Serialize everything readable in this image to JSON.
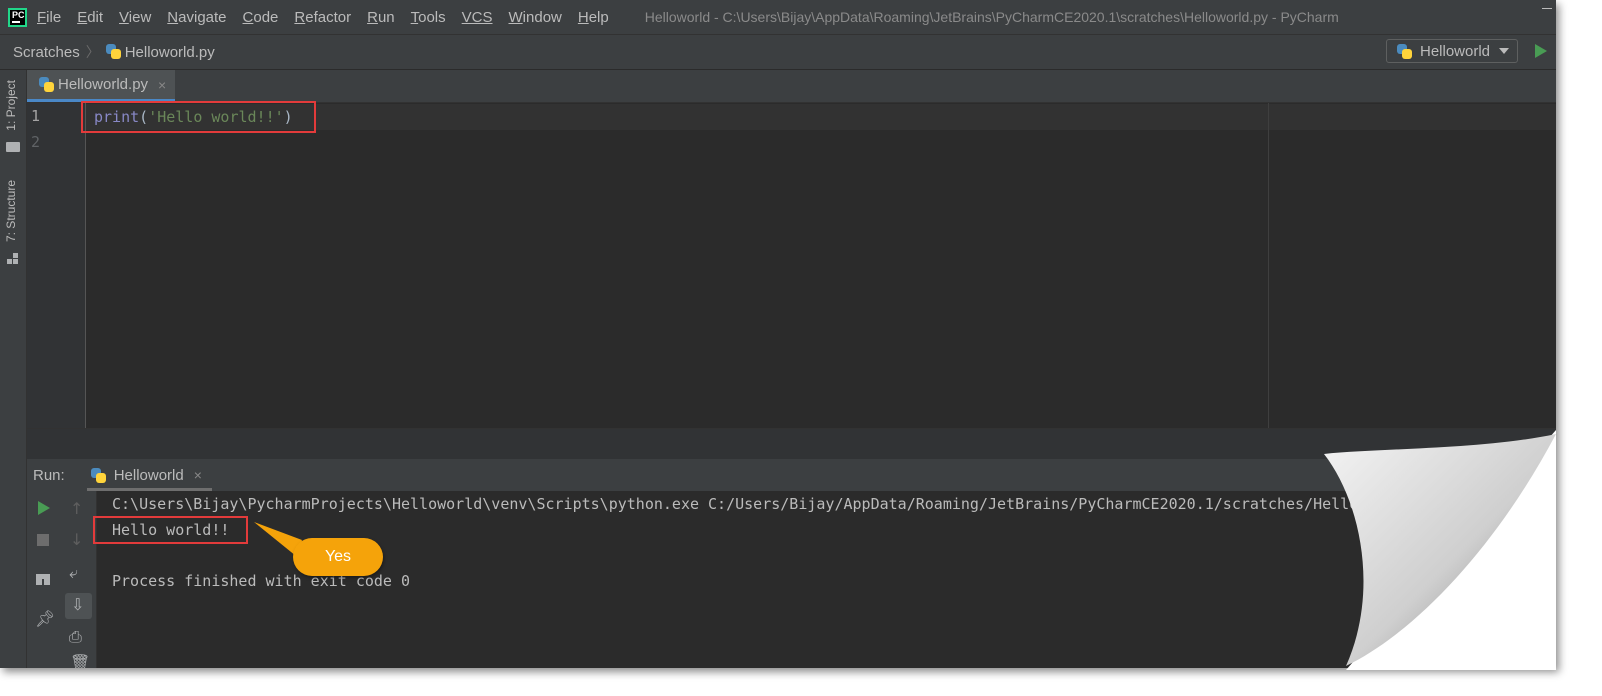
{
  "menubar": {
    "items": [
      {
        "u": "F",
        "rest": "ile"
      },
      {
        "u": "E",
        "rest": "dit"
      },
      {
        "u": "V",
        "rest": "iew"
      },
      {
        "u": "N",
        "rest": "avigate"
      },
      {
        "u": "C",
        "rest": "ode"
      },
      {
        "u": "R",
        "rest": "efactor"
      },
      {
        "u": "R",
        "rest": "un"
      },
      {
        "u": "T",
        "rest": "ools"
      },
      {
        "u": "VCS",
        "rest": ""
      },
      {
        "u": "W",
        "rest": "indow"
      },
      {
        "u": "H",
        "rest": "elp"
      }
    ],
    "window_title": "Helloworld - C:\\Users\\Bijay\\AppData\\Roaming\\JetBrains\\PyCharmCE2020.1\\scratches\\Helloworld.py - PyCharm"
  },
  "navbar": {
    "crumb_root": "Scratches",
    "crumb_file": "Helloworld.py",
    "run_config": "Helloworld"
  },
  "sidebar": {
    "project_label": "1: Project",
    "structure_label": "7: Structure"
  },
  "editor": {
    "tab_label": "Helloworld.py",
    "line_numbers": [
      "1",
      "2"
    ],
    "code": {
      "func": "print",
      "open": "(",
      "string": "'Hello world!!'",
      "close": ")"
    }
  },
  "run_panel": {
    "title": "Run:",
    "tab_label": "Helloworld",
    "console": {
      "command": "C:\\Users\\Bijay\\PycharmProjects\\Helloworld\\venv\\Scripts\\python.exe C:/Users/Bijay/AppData/Roaming/JetBrains/PyCharmCE2020.1/scratches/Helloworld.py",
      "output": "Hello world!!",
      "exit": "Process finished with exit code 0"
    }
  },
  "callout": {
    "text": "Yes"
  },
  "colors": {
    "highlight_box": "#e33b3b",
    "callout": "#f5a30a",
    "run_green": "#499c54",
    "tab_underline": "#4a88c7"
  }
}
